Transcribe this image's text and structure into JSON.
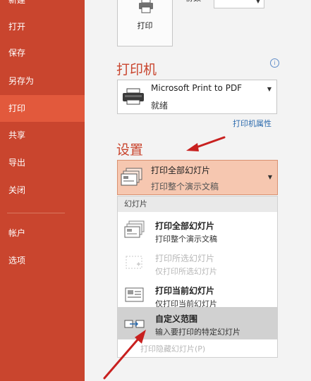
{
  "sidebar": {
    "items": [
      {
        "label": "新建"
      },
      {
        "label": "打开"
      },
      {
        "label": "保存"
      },
      {
        "label": "另存为"
      },
      {
        "label": "打印"
      },
      {
        "label": "共享"
      },
      {
        "label": "导出"
      },
      {
        "label": "关闭"
      },
      {
        "label": "帐户"
      },
      {
        "label": "选项"
      }
    ]
  },
  "print": {
    "button_label": "打印",
    "copies_label": "份数"
  },
  "printer": {
    "section_title": "打印机",
    "name": "Microsoft Print to PDF",
    "status": "就绪",
    "properties_link": "打印机属性"
  },
  "settings": {
    "section_title": "设置",
    "selected_title": "打印全部幻灯片",
    "selected_desc": "打印整个演示文稿",
    "dropdown": {
      "header": "幻灯片",
      "options": [
        {
          "title": "打印全部幻灯片",
          "desc": "打印整个演示文稿"
        },
        {
          "title": "打印所选幻灯片",
          "desc": "仅打印所选幻灯片"
        },
        {
          "title": "打印当前幻灯片",
          "desc": "仅打印当前幻灯片"
        },
        {
          "title": "自定义范围",
          "desc": "输入要打印的特定幻灯片"
        }
      ],
      "hidden_slides": "打印隐藏幻灯片(P)"
    }
  },
  "colors": {
    "sidebar": "#c9452e",
    "sidebar_active": "#e2593c",
    "accent_text": "#c9452e",
    "selected_setting": "#f6c7b0",
    "arrow": "#c8201f"
  }
}
